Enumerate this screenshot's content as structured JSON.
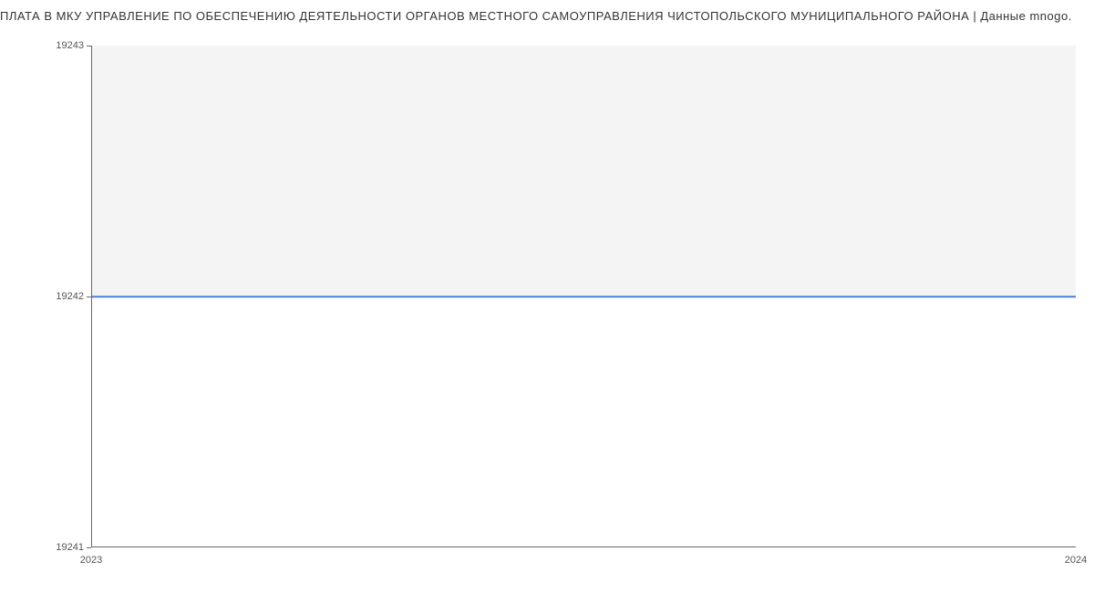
{
  "chart_data": {
    "type": "line",
    "title": "ПЛАТА В МКУ УПРАВЛЕНИЕ ПО ОБЕСПЕЧЕНИЮ ДЕЯТЕЛЬНОСТИ ОРГАНОВ МЕСТНОГО САМОУПРАВЛЕНИЯ ЧИСТОПОЛЬСКОГО МУНИЦИПАЛЬНОГО РАЙОНА | Данные mnogo.",
    "x": [
      2023,
      2024
    ],
    "series": [
      {
        "name": "value",
        "values": [
          19242,
          19242
        ],
        "color": "#4a7fd8"
      }
    ],
    "xlabel": "",
    "ylabel": "",
    "ylim": [
      19241,
      19243
    ],
    "xlim": [
      2023,
      2024
    ],
    "y_ticks": [
      19241,
      19242,
      19243
    ],
    "x_ticks": [
      2023,
      2024
    ]
  },
  "title": "ПЛАТА В МКУ УПРАВЛЕНИЕ ПО ОБЕСПЕЧЕНИЮ ДЕЯТЕЛЬНОСТИ ОРГАНОВ МЕСТНОГО САМОУПРАВЛЕНИЯ ЧИСТОПОЛЬСКОГО МУНИЦИПАЛЬНОГО РАЙОНА | Данные mnogo.",
  "y_labels": {
    "y0": "19241",
    "y1": "19242",
    "y2": "19243"
  },
  "x_labels": {
    "x0": "2023",
    "x1": "2024"
  }
}
